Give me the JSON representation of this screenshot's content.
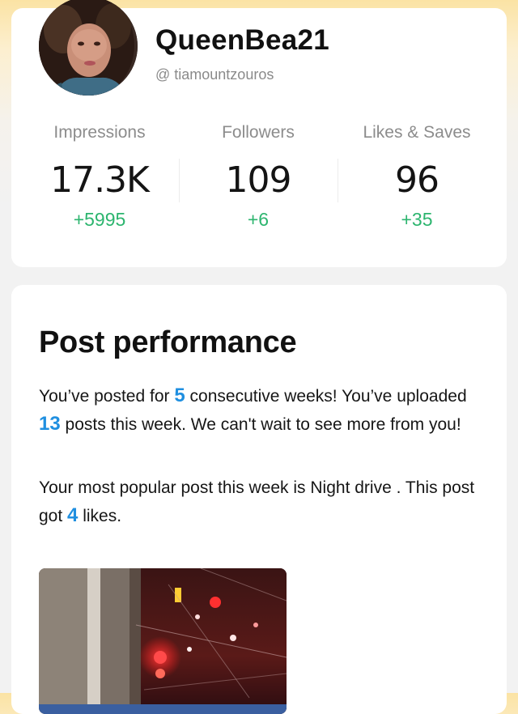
{
  "profile": {
    "username": "QueenBea21",
    "handle": "@ tiamountzouros",
    "avatar_icon": "profile-photo"
  },
  "stats": [
    {
      "label": "Impressions",
      "value": "17.3K",
      "delta": "+5995"
    },
    {
      "label": "Followers",
      "value": "109",
      "delta": "+6"
    },
    {
      "label": "Likes & Saves",
      "value": "96",
      "delta": "+35"
    }
  ],
  "performance": {
    "title": "Post performance",
    "para1": {
      "a": "You’ve posted for ",
      "weeks": "5",
      "b": " consecutive weeks! You’ve uploaded ",
      "posts": "13",
      "c": " posts this week. We can't wait to see more from you!"
    },
    "para2": {
      "a": "Your most popular post this week is Night drive . This post got ",
      "likes": "4",
      "b": " likes."
    },
    "post_image": "night-drive-photo"
  },
  "colors": {
    "accent_blue": "#1f8fe0",
    "delta_green": "#2db56f"
  }
}
